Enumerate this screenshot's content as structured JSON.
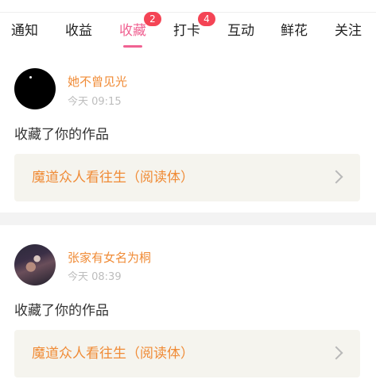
{
  "tabs": [
    {
      "label": "通知",
      "badge": null
    },
    {
      "label": "收益",
      "badge": null
    },
    {
      "label": "收藏",
      "badge": "2",
      "active": true
    },
    {
      "label": "打卡",
      "badge": "4"
    },
    {
      "label": "互动",
      "badge": null
    },
    {
      "label": "鲜花",
      "badge": null
    },
    {
      "label": "关注",
      "badge": null
    }
  ],
  "colors": {
    "accent_pink": "#f06292",
    "badge_red": "#f44455",
    "name_orange": "#f08b36",
    "box_bg": "#f5f4ee"
  },
  "feed": [
    {
      "user": "她不曾见光",
      "time": "今天 09:15",
      "action": "收藏了你的作品",
      "work_title": "魔道众人看往生（阅读体）",
      "avatar": "black-avatar-icon"
    },
    {
      "user": "张家有女名为桐",
      "time": "今天 08:39",
      "action": "收藏了你的作品",
      "work_title": "魔道众人看往生（阅读体）",
      "avatar": "photo-avatar-icon"
    }
  ]
}
